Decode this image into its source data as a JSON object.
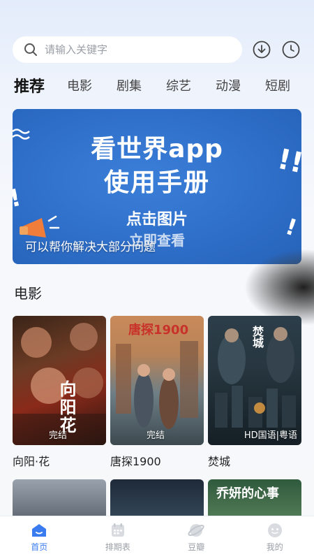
{
  "search": {
    "placeholder": "请输入关键字"
  },
  "tabs": [
    {
      "label": "推荐"
    },
    {
      "label": "电影"
    },
    {
      "label": "剧集"
    },
    {
      "label": "综艺"
    },
    {
      "label": "动漫"
    },
    {
      "label": "短剧"
    }
  ],
  "banner": {
    "title_line1": "看世界app",
    "title_line2": "使用手册",
    "cta_line1": "点击图片",
    "cta_line2": "立即查看",
    "caption": "可以帮你解决大部分问题"
  },
  "section": {
    "title": "电影"
  },
  "movies": [
    {
      "name": "向阳·花",
      "badge": "完结",
      "overlay": "向阳花"
    },
    {
      "name": "唐探1900",
      "badge": "完结",
      "overlay": "唐探1900"
    },
    {
      "name": "焚城",
      "badge": "HD国语|粤语",
      "overlay": "焚城"
    }
  ],
  "row2": [
    {
      "overlay": ""
    },
    {
      "overlay": ""
    },
    {
      "overlay": "乔妍的心事"
    }
  ],
  "nav": [
    {
      "label": "首页",
      "icon": "home-icon",
      "active": true
    },
    {
      "label": "排期表",
      "icon": "calendar-icon",
      "active": false
    },
    {
      "label": "豆瓣",
      "icon": "planet-icon",
      "active": false
    },
    {
      "label": "我的",
      "icon": "face-icon",
      "active": false
    }
  ],
  "colors": {
    "accent": "#3a7cf0",
    "banner": "#2f6fc9"
  }
}
